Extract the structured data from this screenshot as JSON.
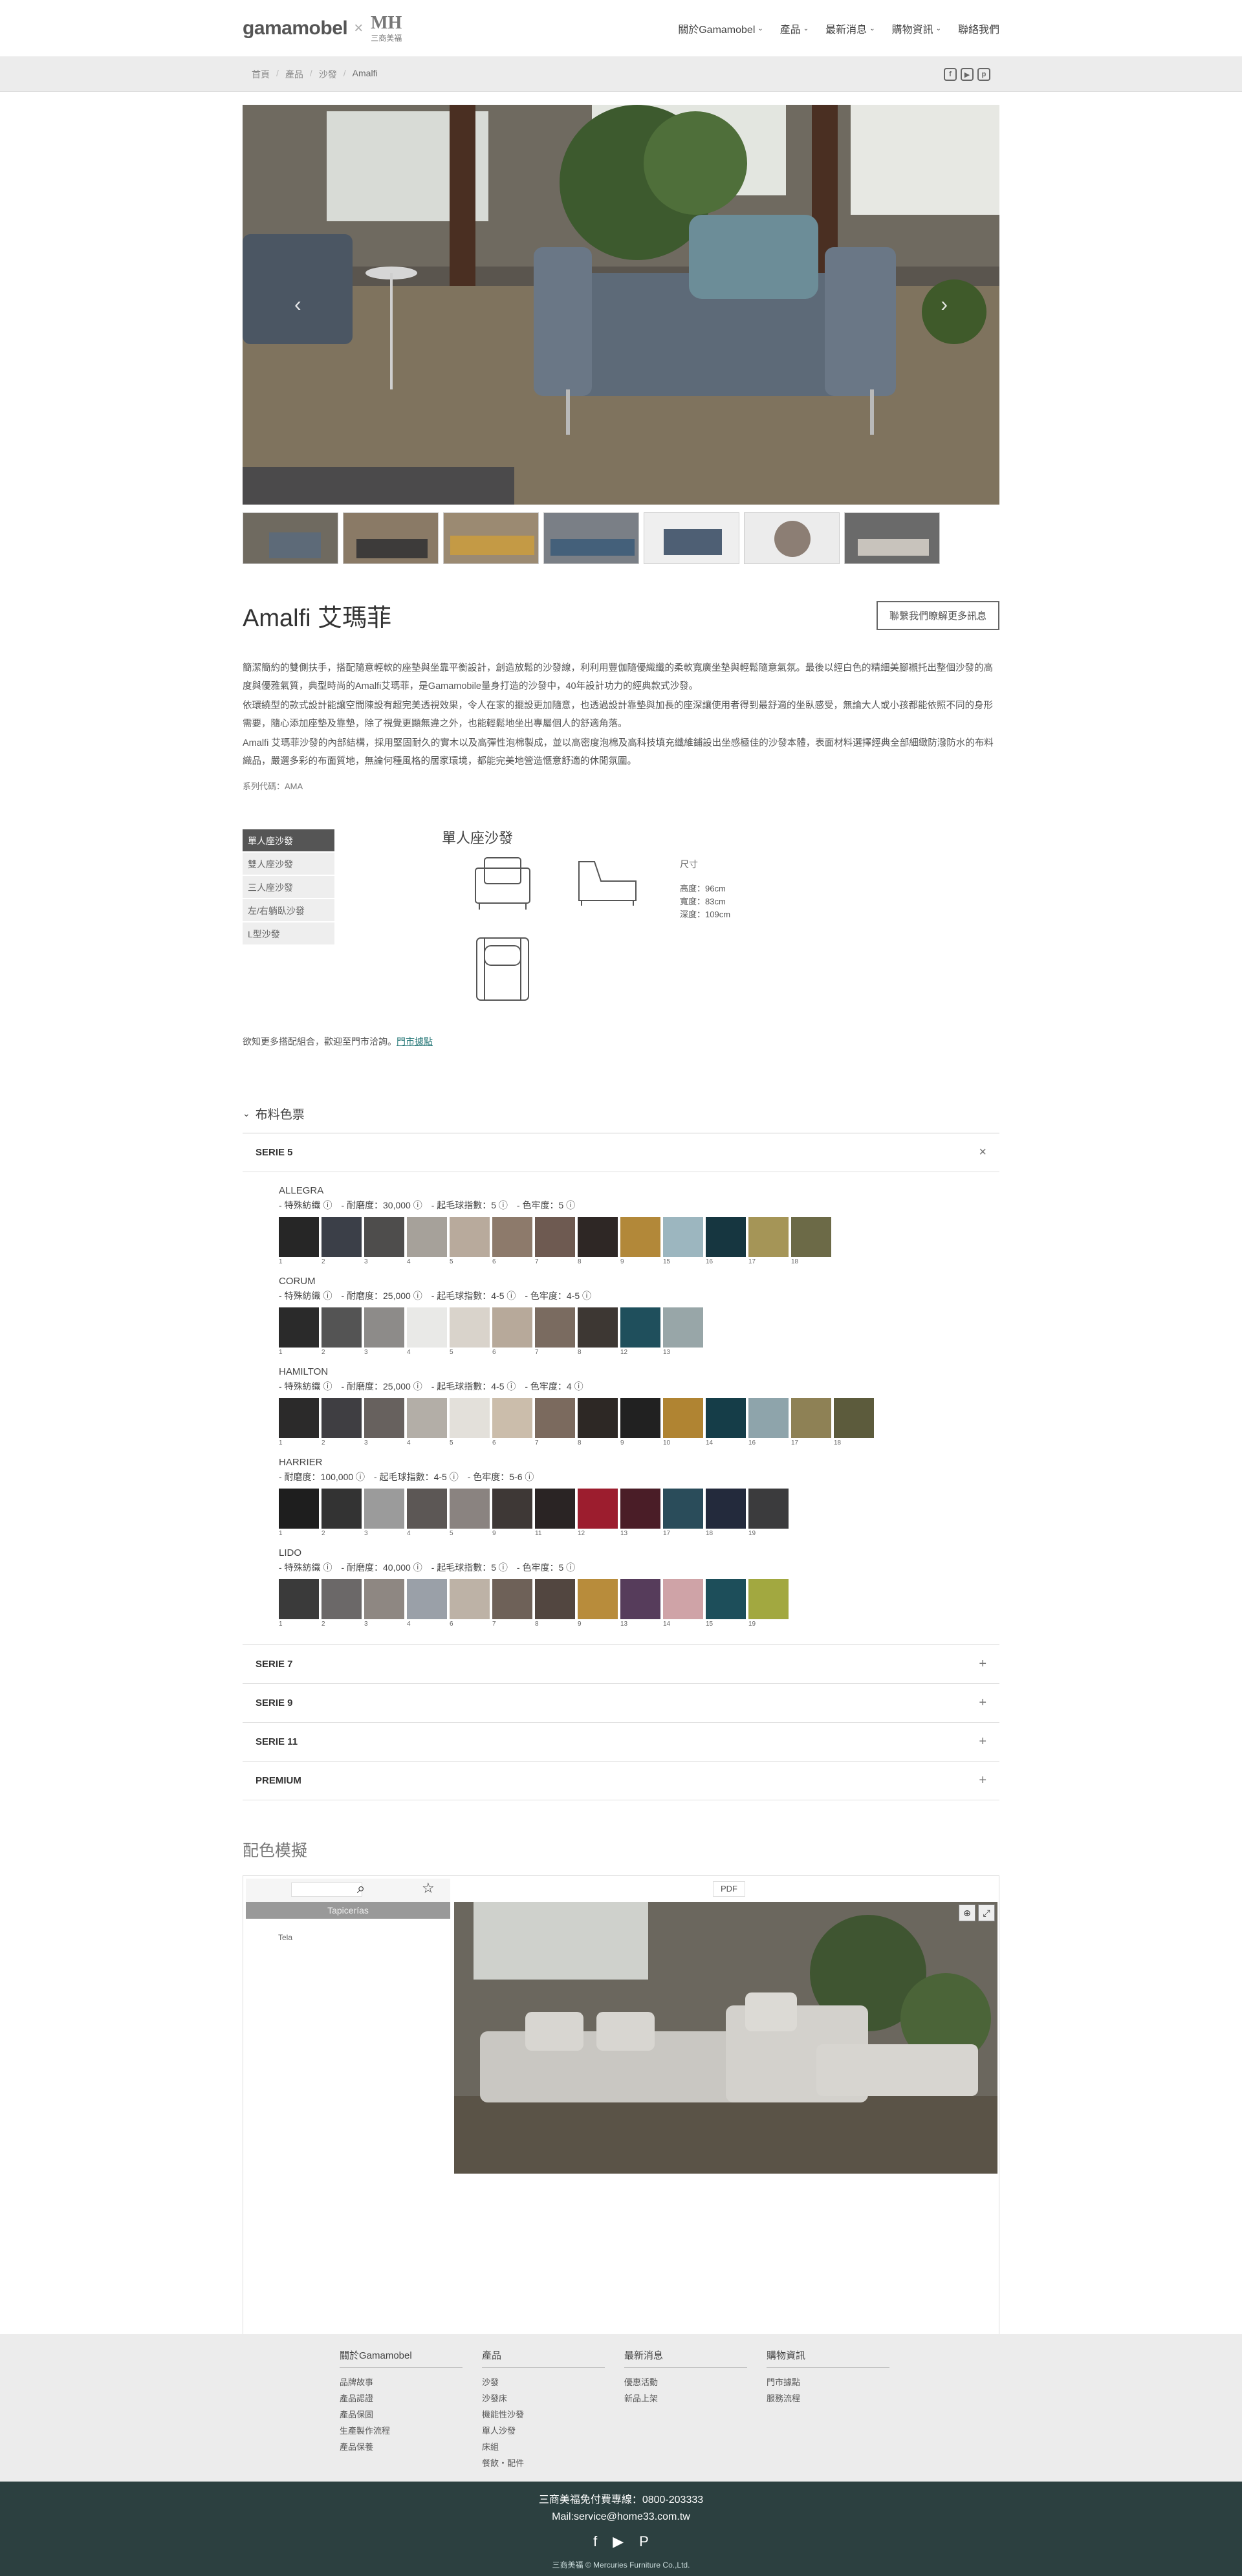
{
  "header": {
    "brand": "gamamobel",
    "brand_sep": "×",
    "partner_logo": "MH",
    "partner_name": "三商美福",
    "nav": [
      {
        "label": "關於Gamamobel",
        "chev": "chevron-down-icon"
      },
      {
        "label": "產品",
        "chev": "chevron-down-icon"
      },
      {
        "label": "最新消息",
        "chev": "chevron-down-icon"
      },
      {
        "label": "購物資訊",
        "chev": "chevron-down-icon"
      },
      {
        "label": "聯絡我們"
      }
    ]
  },
  "breadcrumb": [
    "首頁",
    "產品",
    "沙發",
    "Amalfi"
  ],
  "social_icons": [
    "facebook-icon",
    "youtube-icon",
    "pinterest-icon"
  ],
  "product": {
    "title": "Amalfi 艾瑪菲",
    "contact_btn": "聯繫我們瞭解更多訊息",
    "desc": [
      "簡潔簡約的雙側扶手，搭配隨意輕軟的座墊與坐靠平衡設計，創造放鬆的沙發線，利利用豐伽隨優織纖的柔軟寬廣坐墊與輕鬆隨意氣氛。最後以經白色的精細美腳襯托出整個沙發的高度與優雅氣質，典型時尚的Amalfi艾瑪菲，是Gamamobile量身打造的沙發中，40年設計功力的經典款式沙發。",
      "依環繞型的款式設計能讓空間陳設有超完美透視效果，令人在家的擺設更加隨意，也透過設計靠墊與加長的座深讓使用者得到最舒適的坐臥感受，無論大人或小孩都能依照不同的身形需要，隨心添加座墊及靠墊，除了視覺更顯無違之外，也能輕鬆地坐出專屬個人的舒適角落。",
      "Amalfi 艾瑪菲沙發的內部結構，採用堅固耐久的實木以及高彈性泡棉製成，並以高密度泡棉及高科技填充纖維鋪設出坐感極佳的沙發本體，表面材料選擇經典全部細緻防潑防水的布料織品，嚴選多彩的布面質地，無論何種風格的居家環境，都能完美地營造愜意舒適的休閒氛圍。"
    ],
    "code": "系列代碼：AMA"
  },
  "variants": {
    "tabs": [
      "單人座沙發",
      "雙人座沙發",
      "三人座沙發",
      "左/右躺臥沙發",
      "L型沙發"
    ],
    "active": 0,
    "title": "單人座沙發",
    "dims_title": "尺寸",
    "dims": [
      "高度：96cm",
      "寬度：83cm",
      "深度：109cm"
    ],
    "more_text": "欲知更多搭配組合，歡迎至門市洽詢。",
    "more_link": "門市據點"
  },
  "fabric": {
    "title": "布料色票",
    "open_serie": "SERIE 5",
    "close_icon": "×",
    "series_collapsed": [
      "SERIE 7",
      "SERIE 9",
      "SERIE 11",
      "PREMIUM"
    ],
    "plus_icon": "+",
    "fabrics": [
      {
        "name": "ALLEGRA",
        "spec": "- 特殊紡織 ⓘ　- 耐磨度：30,000 ⓘ　- 起毛球指數：5 ⓘ　- 色牢度：5 ⓘ",
        "swatches": [
          {
            "n": "1",
            "c": "#262626"
          },
          {
            "n": "2",
            "c": "#3b3f48"
          },
          {
            "n": "3",
            "c": "#4e4d4c"
          },
          {
            "n": "4",
            "c": "#a6a19a"
          },
          {
            "n": "5",
            "c": "#b8aa9c"
          },
          {
            "n": "6",
            "c": "#8d7a6b"
          },
          {
            "n": "7",
            "c": "#6e5a51"
          },
          {
            "n": "8",
            "c": "#2e2725"
          },
          {
            "n": "9",
            "c": "#b28839"
          },
          {
            "n": "15",
            "c": "#9cb6bf"
          },
          {
            "n": "16",
            "c": "#163640"
          },
          {
            "n": "17",
            "c": "#a59557"
          },
          {
            "n": "18",
            "c": "#6c6a47"
          }
        ]
      },
      {
        "name": "CORUM",
        "spec": "- 特殊紡織 ⓘ　- 耐磨度：25,000 ⓘ　- 起毛球指數：4-5 ⓘ　- 色牢度：4-5 ⓘ",
        "swatches": [
          {
            "n": "1",
            "c": "#2a2a2a"
          },
          {
            "n": "2",
            "c": "#545454"
          },
          {
            "n": "3",
            "c": "#8d8b89"
          },
          {
            "n": "4",
            "c": "#e9e9e7"
          },
          {
            "n": "5",
            "c": "#d9d3cb"
          },
          {
            "n": "6",
            "c": "#b7a99a"
          },
          {
            "n": "7",
            "c": "#7a6b60"
          },
          {
            "n": "8",
            "c": "#3d3733"
          },
          {
            "n": "12",
            "c": "#1f4f5c"
          },
          {
            "n": "13",
            "c": "#98a6a8"
          }
        ]
      },
      {
        "name": "HAMILTON",
        "spec": "- 特殊紡織 ⓘ　- 耐磨度：25,000 ⓘ　- 起毛球指數：4-5 ⓘ　- 色牢度：4 ⓘ",
        "swatches": [
          {
            "n": "1",
            "c": "#2b2a2a"
          },
          {
            "n": "2",
            "c": "#3f3e42"
          },
          {
            "n": "3",
            "c": "#67615e"
          },
          {
            "n": "4",
            "c": "#b3aea7"
          },
          {
            "n": "5",
            "c": "#e3e0da"
          },
          {
            "n": "6",
            "c": "#cbbdab"
          },
          {
            "n": "7",
            "c": "#7b6a5e"
          },
          {
            "n": "8",
            "c": "#2d2825"
          },
          {
            "n": "9",
            "c": "#212121"
          },
          {
            "n": "10",
            "c": "#b08432"
          },
          {
            "n": "14",
            "c": "#153d48"
          },
          {
            "n": "16",
            "c": "#8ea4ab"
          },
          {
            "n": "17",
            "c": "#8e8155"
          },
          {
            "n": "18",
            "c": "#5c5b3c"
          }
        ]
      },
      {
        "name": "HARRIER",
        "spec": "- 耐磨度：100,000 ⓘ　- 起毛球指數：4-5 ⓘ　- 色牢度：5-6 ⓘ",
        "swatches": [
          {
            "n": "1",
            "c": "#1e1e1e"
          },
          {
            "n": "2",
            "c": "#333333"
          },
          {
            "n": "3",
            "c": "#9b9b9b"
          },
          {
            "n": "4",
            "c": "#5c5755"
          },
          {
            "n": "5",
            "c": "#8a8380"
          },
          {
            "n": "9",
            "c": "#3e3836"
          },
          {
            "n": "11",
            "c": "#2a2424"
          },
          {
            "n": "12",
            "c": "#9c1d2e"
          },
          {
            "n": "13",
            "c": "#4a1d27"
          },
          {
            "n": "17",
            "c": "#2a4c5a"
          },
          {
            "n": "18",
            "c": "#232a3c"
          },
          {
            "n": "19",
            "c": "#3b3b3d"
          }
        ]
      },
      {
        "name": "LIDO",
        "spec": "- 特殊紡織 ⓘ　- 耐磨度：40,000 ⓘ　- 起毛球指數：5 ⓘ　- 色牢度：5 ⓘ",
        "swatches": [
          {
            "n": "1",
            "c": "#3a3a3a"
          },
          {
            "n": "2",
            "c": "#6b6868"
          },
          {
            "n": "3",
            "c": "#8e8782"
          },
          {
            "n": "4",
            "c": "#9aa0a8"
          },
          {
            "n": "6",
            "c": "#bdb2a6"
          },
          {
            "n": "7",
            "c": "#6e6158"
          },
          {
            "n": "8",
            "c": "#524640"
          },
          {
            "n": "9",
            "c": "#b88c3b"
          },
          {
            "n": "13",
            "c": "#563c5b"
          },
          {
            "n": "14",
            "c": "#cfa3a7"
          },
          {
            "n": "15",
            "c": "#1d4e5a"
          },
          {
            "n": "19",
            "c": "#a2a840"
          }
        ]
      }
    ]
  },
  "configurator": {
    "title": "配色模擬",
    "tab": "Tapicerías",
    "item": "Tela",
    "pdf": "PDF",
    "search_icon": "search-icon",
    "star_icon": "star-icon"
  },
  "footer": {
    "cols": [
      {
        "head": "關於Gamamobel",
        "links": [
          "品牌故事",
          "產品認證",
          "產品保固",
          "生產製作流程",
          "產品保養"
        ]
      },
      {
        "head": "產品",
        "links": [
          "沙發",
          "沙發床",
          "機能性沙發",
          "單人沙發",
          "床組",
          "餐飲・配件"
        ]
      },
      {
        "head": "最新消息",
        "links": [
          "優惠活動",
          "新品上架"
        ]
      },
      {
        "head": "購物資訊",
        "links": [
          "門市據點",
          "服務流程"
        ]
      }
    ],
    "hotline": "三商美福免付費專線：0800-203333",
    "mail": "Mail:service@home33.com.tw",
    "copyright": "三商美福 © Mercuries Furniture Co.,Ltd."
  }
}
